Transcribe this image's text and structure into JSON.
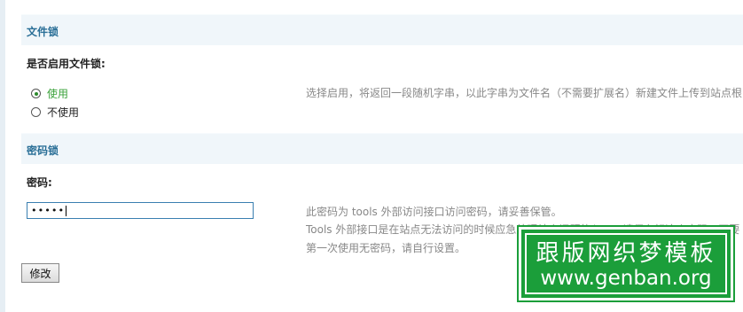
{
  "sections": {
    "filelock": {
      "title": "文件锁",
      "field_label": "是否启用文件锁:",
      "options": [
        {
          "label": "使用",
          "checked": true
        },
        {
          "label": "不使用",
          "checked": false
        }
      ],
      "hint": "选择启用，将返回一段随机字串，以此字串为文件名（不需要扩展名）新建文件上传到站点根"
    },
    "password": {
      "title": "密码锁",
      "field_label": "密码:",
      "input_value": "•••••",
      "hint_lines": [
        "此密码为 tools 外部访问接口访问密码，请妥善保管。",
        "Tools 外部接口是在站点无法访问的时候应急处理站点问题的入口。请保存好这个密码，不要",
        "第一次使用无密码，请自行设置。"
      ]
    }
  },
  "submit_label": "修改",
  "watermark": {
    "line1": "跟版网织梦模板",
    "line2": "www.genban.org"
  },
  "colors": {
    "section_header_bg": "#f0f6fa",
    "section_title": "#2a6f97",
    "watermark_bg": "#1b9e3a"
  }
}
